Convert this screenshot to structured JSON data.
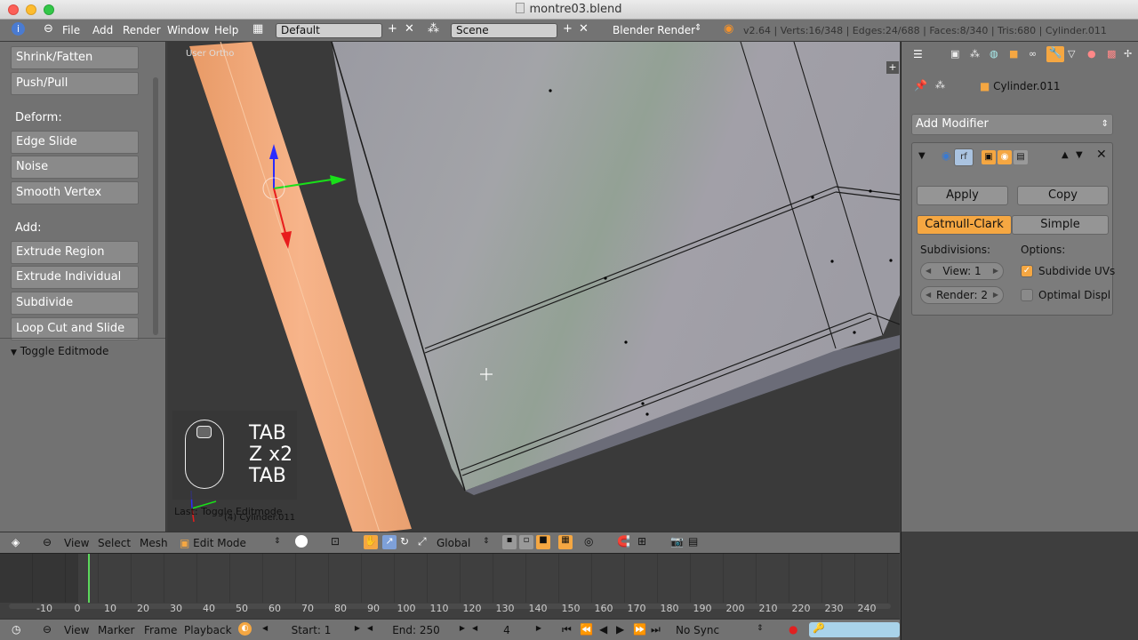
{
  "window": {
    "title": "montre03.blend"
  },
  "menubar": {
    "menus": [
      "File",
      "Add",
      "Render",
      "Window",
      "Help"
    ],
    "layout": "Default",
    "scene": "Scene",
    "engine": "Blender Render",
    "stats": "v2.64 | Verts:16/348 | Edges:24/688 | Faces:8/340 | Tris:680 | Cylinder.011"
  },
  "toolshelf": {
    "top_buttons": [
      "Shrink/Fatten",
      "Push/Pull"
    ],
    "deform_label": "Deform:",
    "deform_buttons": [
      "Edge Slide",
      "Noise",
      "Smooth Vertex"
    ],
    "add_label": "Add:",
    "add_buttons": [
      "Extrude Region",
      "Extrude Individual",
      "Subdivide",
      "Loop Cut and Slide"
    ],
    "last_op_header": "Toggle Editmode"
  },
  "viewport": {
    "view_label": "User Ortho",
    "key_lines": [
      "TAB",
      "Z x2",
      "TAB"
    ],
    "last_op": "Last: Toggle Editmode",
    "object_label": "(4) Cylinder.011"
  },
  "properties": {
    "object_name": "Cylinder.011",
    "add_modifier": "Add Modifier",
    "apply": "Apply",
    "copy": "Copy",
    "catmull": "Catmull-Clark",
    "simple": "Simple",
    "subdivisions_label": "Subdivisions:",
    "options_label": "Options:",
    "view_field": "View: 1",
    "render_field": "Render: 2",
    "subdivide_uvs": "Subdivide UVs",
    "optimal_display": "Optimal Displ",
    "subdivide_uvs_checked": true,
    "optimal_display_checked": false,
    "accent": "#f5a742"
  },
  "view_header": {
    "items": [
      "View",
      "Select",
      "Mesh"
    ],
    "mode": "Edit Mode",
    "orientation": "Global"
  },
  "timeline": {
    "ticks": [
      "-10",
      "0",
      "10",
      "20",
      "30",
      "40",
      "50",
      "60",
      "70",
      "80",
      "90",
      "100",
      "110",
      "120",
      "130",
      "140",
      "150",
      "160",
      "170",
      "180",
      "190",
      "200",
      "210",
      "220",
      "230",
      "240"
    ],
    "current_frame_value": 4
  },
  "timeline_header": {
    "items": [
      "View",
      "Marker",
      "Frame",
      "Playback"
    ],
    "start": "Start: 1",
    "end": "End: 250",
    "current": "4",
    "sync": "No Sync"
  }
}
